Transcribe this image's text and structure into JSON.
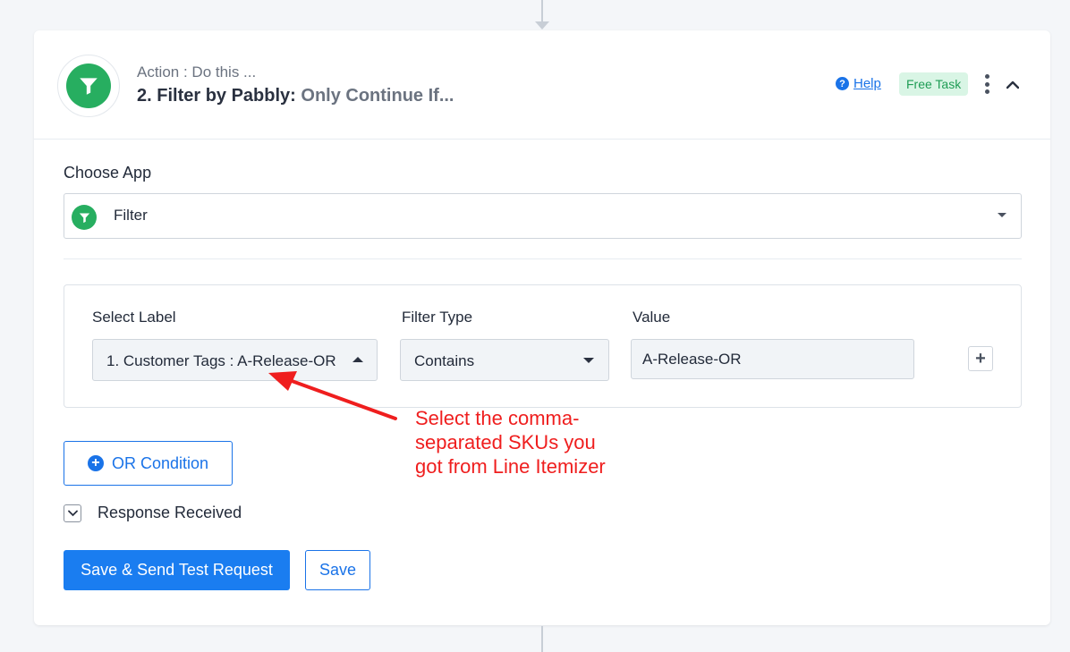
{
  "header": {
    "subtitle": "Action : Do this ...",
    "title_prefix": "2. Filter by Pabbly:",
    "title_suffix": " Only Continue If...",
    "help_label": "Help",
    "help_icon": "question-circle-icon",
    "badge": "Free Task"
  },
  "choose_app": {
    "label": "Choose App",
    "selected": "Filter",
    "icon": "filter-icon"
  },
  "filter_row": {
    "select_label_title": "Select Label",
    "select_label_value": "1. Customer Tags : A-Release-OR",
    "filter_type_title": "Filter Type",
    "filter_type_value": "Contains",
    "value_title": "Value",
    "value_input": "A-Release-OR",
    "add_button": "+"
  },
  "or_condition": {
    "label": "OR Condition",
    "icon": "plus-circle-icon"
  },
  "response": {
    "label": "Response Received"
  },
  "actions": {
    "primary": "Save & Send Test Request",
    "secondary": "Save"
  },
  "annotation": {
    "line1": "Select the comma-",
    "line2": "separated SKUs you",
    "line3": "got from Line Itemizer",
    "color": "#ef1e1e"
  },
  "colors": {
    "accent": "#1a73e8",
    "app_green": "#27ae60",
    "badge_bg": "#d9f5e5"
  }
}
